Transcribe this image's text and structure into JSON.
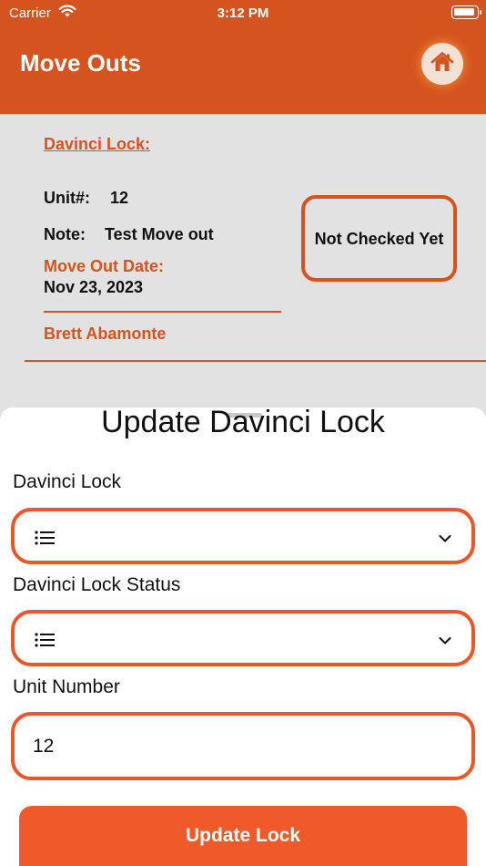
{
  "status_bar": {
    "carrier": "Carrier",
    "time": "3:12 PM"
  },
  "header": {
    "title": "Move Outs",
    "home_icon": "house-icon",
    "background_color": "#d4531f"
  },
  "card": {
    "lock_link": "Davinci Lock:",
    "unit_label": "Unit#:",
    "unit_value": "12",
    "note_label": "Note:",
    "note_value": "Test Move out",
    "move_out_label": "Move Out Date:",
    "move_out_date": "Nov 23, 2023",
    "tenant_name": "Brett Abamonte",
    "status": "Not Checked Yet",
    "accent_color": "#d4531f"
  },
  "sheet": {
    "title": "Update Davinci Lock",
    "lock_label": "Davinci Lock",
    "lock_value": "",
    "status_label": "Davinci Lock Status",
    "status_value": "",
    "unit_label": "Unit Number",
    "unit_value": "12",
    "submit_label": "Update Lock",
    "button_color": "#f05a2a"
  }
}
